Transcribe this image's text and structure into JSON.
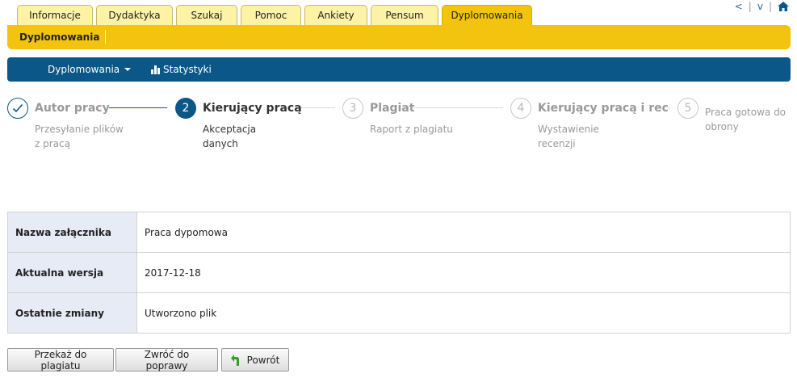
{
  "tabs": [
    {
      "label": "Informacje",
      "active": false
    },
    {
      "label": "Dydaktyka",
      "active": false
    },
    {
      "label": "Szukaj",
      "active": false
    },
    {
      "label": "Pomoc",
      "active": false
    },
    {
      "label": "Ankiety",
      "active": false
    },
    {
      "label": "Pensum",
      "active": false
    },
    {
      "label": "Dyplomowania",
      "active": true
    }
  ],
  "topright": {
    "prev": "<",
    "next": "v",
    "separator": "|",
    "home_icon": "home-icon"
  },
  "subbar": {
    "title": "Dyplomowania"
  },
  "nav": {
    "menu_label": "Dyplomowania",
    "stats_label": "Statystyki",
    "stats_icon": "bar-chart-icon"
  },
  "steps": [
    {
      "number": "✓",
      "title": "Autor pracy",
      "desc_line1": "Przesyłanie plików",
      "desc_line2": "z pracą",
      "state": "done"
    },
    {
      "number": "2",
      "title": "Kierujący pracą",
      "desc_line1": "Akceptacja",
      "desc_line2": "danych",
      "state": "current"
    },
    {
      "number": "3",
      "title": "Plagiat",
      "desc_line1": "Raport z plagiatu",
      "desc_line2": "",
      "state": "todo"
    },
    {
      "number": "4",
      "title": "Kierujący pracą i recenz",
      "desc_line1": "Wystawienie",
      "desc_line2": "recenzji",
      "state": "todo"
    },
    {
      "number": "5",
      "title": "",
      "desc_line1": "Praca gotowa do",
      "desc_line2": "obrony",
      "state": "todo"
    }
  ],
  "details": {
    "rows": [
      {
        "key": "Nazwa załącznika",
        "value": "Praca dypomowa"
      },
      {
        "key": "Aktualna wersja",
        "value": "2017-12-18"
      },
      {
        "key": "Ostatnie zmiany",
        "value": "Utworzono plik"
      }
    ]
  },
  "buttons": {
    "send_to_plagiarism": "Przekaż do plagiatu",
    "return_for_correction": "Zwróć do poprawy",
    "back": "Powrót"
  },
  "colors": {
    "accent_blue": "#0b5788",
    "yellow": "#f2c40f",
    "tab_inactive": "#fdf3a6",
    "table_key_bg": "#e7ebf6"
  }
}
